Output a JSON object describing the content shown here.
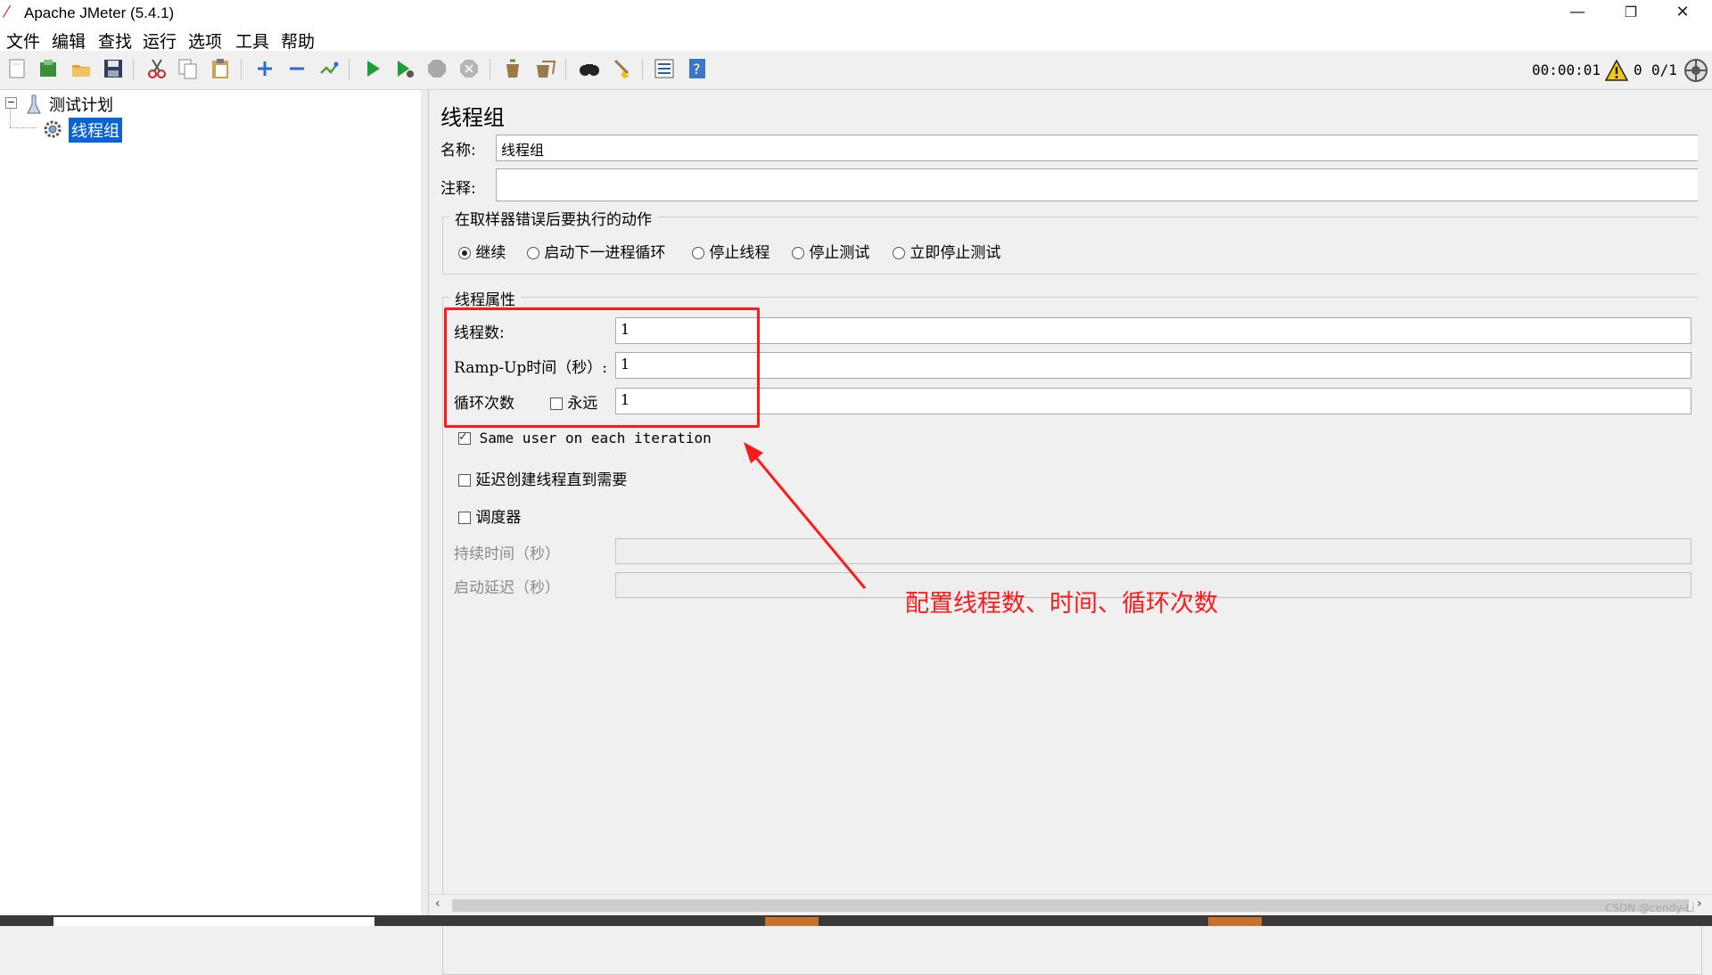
{
  "window": {
    "title": "Apache JMeter (5.4.1)",
    "minimize_glyph": "—",
    "restore_glyph": "❐",
    "close_glyph": "✕"
  },
  "menu": [
    "文件",
    "编辑",
    "查找",
    "运行",
    "选项",
    "工具",
    "帮助"
  ],
  "toolbar": {
    "icons": [
      "new-icon",
      "templates-icon",
      "open-icon",
      "save-icon",
      "cut-icon",
      "copy-icon",
      "paste-icon",
      "expand-icon",
      "collapse-icon",
      "toggle-icon",
      "start-icon",
      "start-no-pause-icon",
      "stop-icon",
      "shutdown-icon",
      "clear-icon",
      "clear-all-icon",
      "search-icon",
      "reset-search-icon",
      "function-helper-icon",
      "help-icon"
    ],
    "timer": "00:00:01",
    "error_count": "0",
    "threads": "0/1"
  },
  "tree": {
    "root": "测试计划",
    "child": "线程组"
  },
  "panel": {
    "title": "线程组",
    "name_label": "名称:",
    "name_value": "线程组",
    "comment_label": "注释:",
    "comment_value": "",
    "error_action": {
      "legend": "在取样器错误后要执行的动作",
      "options": [
        "继续",
        "启动下一进程循环",
        "停止线程",
        "停止测试",
        "立即停止测试"
      ],
      "selected": "继续"
    },
    "thread_props": {
      "legend": "线程属性",
      "threads_label": "线程数:",
      "threads_value": "1",
      "rampup_label": "Ramp-Up时间（秒）:",
      "rampup_value": "1",
      "loop_label": "循环次数",
      "forever_label": "永远",
      "forever_checked": false,
      "loop_value": "1",
      "same_user_label": "Same user on each iteration",
      "same_user_checked": true,
      "delay_label": "延迟创建线程直到需要",
      "delay_checked": false,
      "scheduler_label": "调度器",
      "scheduler_checked": false,
      "duration_label": "持续时间（秒）",
      "duration_value": "",
      "startup_delay_label": "启动延迟（秒）",
      "startup_delay_value": ""
    }
  },
  "annotation": {
    "text": "配置线程数、时间、循环次数",
    "color": "#ff1a1a"
  },
  "watermark": "CSDN @cendy-Li"
}
